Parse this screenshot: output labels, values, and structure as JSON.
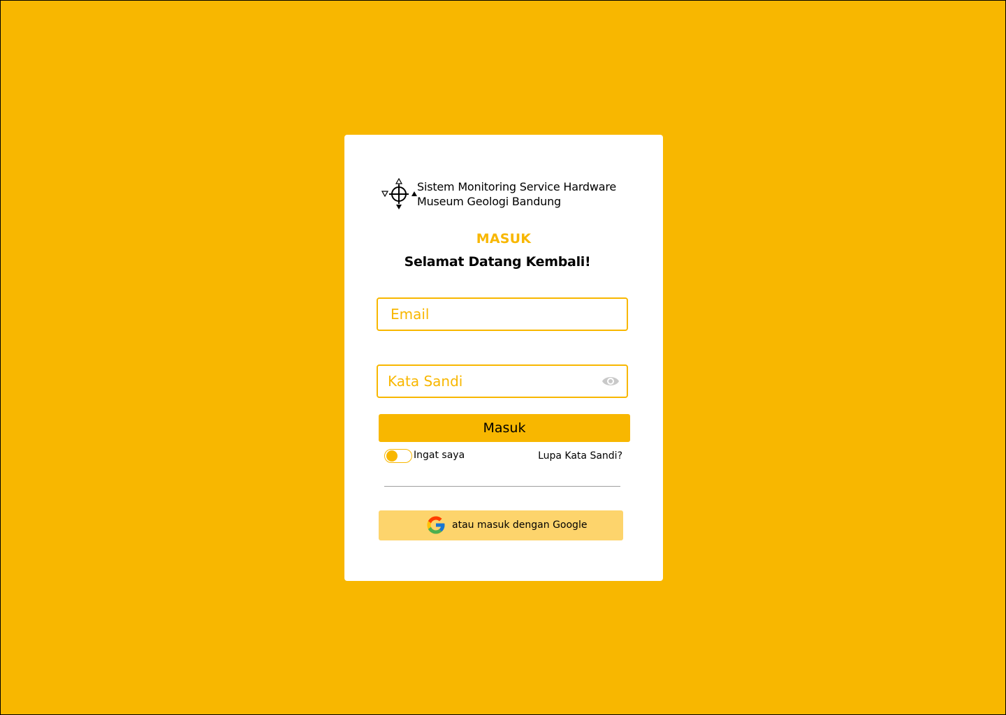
{
  "brand": {
    "line1": "Sistem Monitoring Service Hardware",
    "line2": "Museum Geologi Bandung",
    "logo_icon": "compass-crosshair-icon"
  },
  "login": {
    "heading": "MASUK",
    "welcome": "Selamat Datang Kembali!",
    "email": {
      "placeholder": "Email",
      "value": ""
    },
    "password": {
      "placeholder": "Kata Sandi",
      "value": "",
      "toggle_icon": "eye-icon"
    },
    "submit_label": "Masuk",
    "remember_label": "Ingat saya",
    "forgot_label": "Lupa Kata Sandi?",
    "google_label": "atau masuk dengan Google",
    "google_icon": "google-icon"
  },
  "colors": {
    "background": "#F8B700",
    "accent": "#F8B700",
    "google_button": "#FDD46C",
    "card": "#FFFFFF"
  }
}
